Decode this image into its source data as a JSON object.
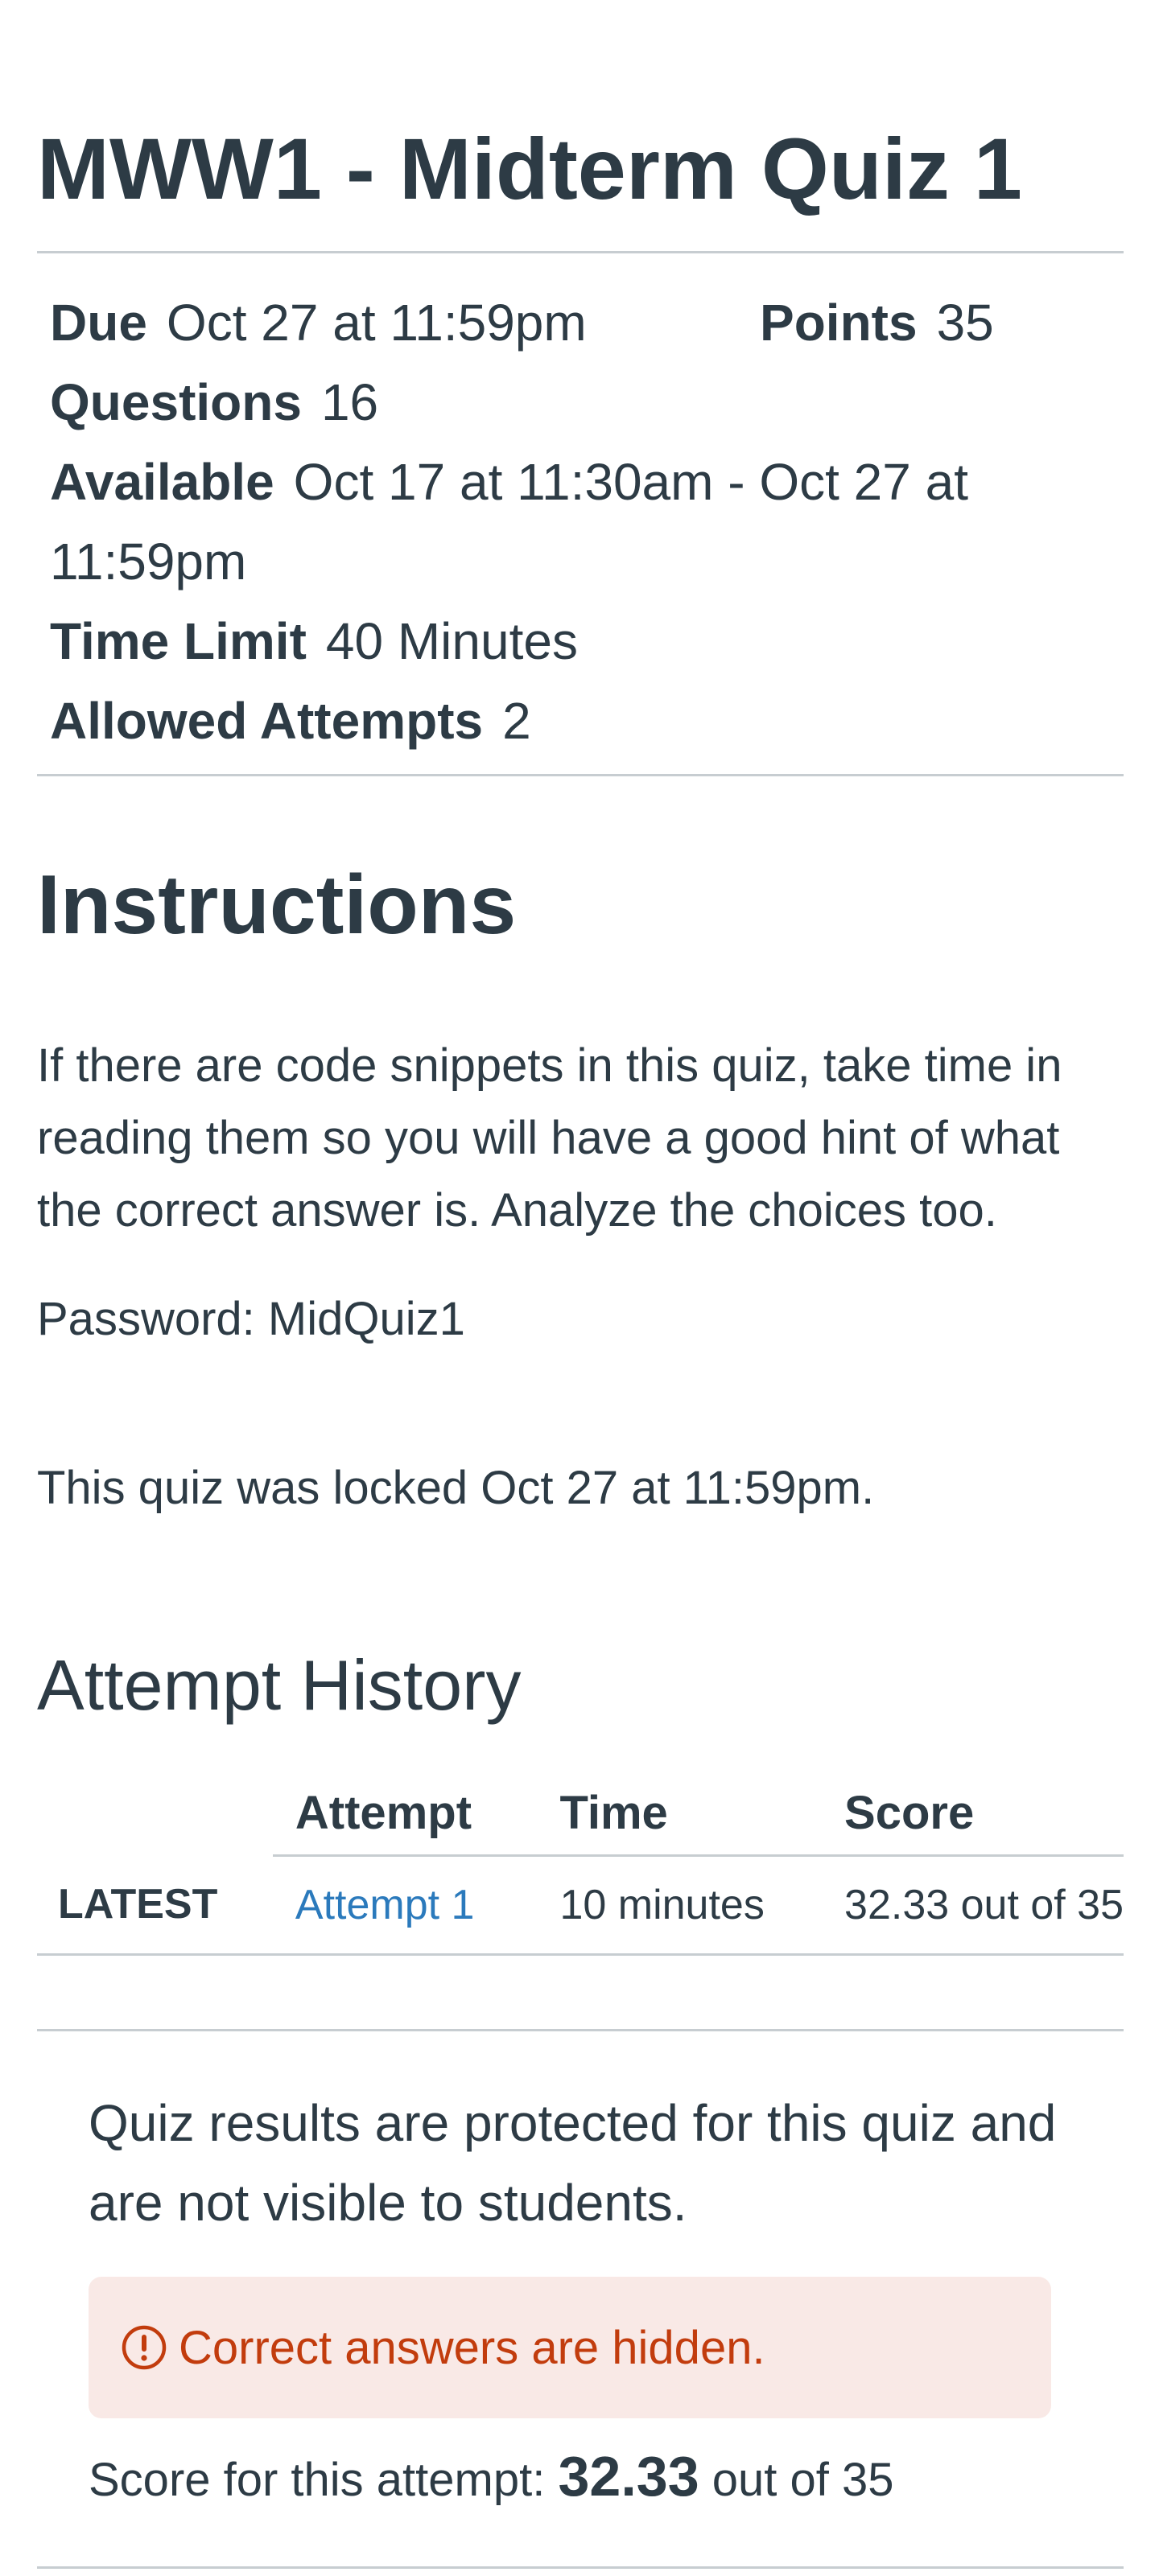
{
  "quiz": {
    "title": "MWW1 - Midterm Quiz 1"
  },
  "details": {
    "due_label": "Due",
    "due_value": "Oct 27 at 11:59pm",
    "points_label": "Points",
    "points_value": "35",
    "questions_label": "Questions",
    "questions_value": "16",
    "available_label": "Available",
    "available_value_line1": "Oct 17 at 11:30am - Oct 27 at",
    "available_value_line2": "11:59pm",
    "time_limit_label": "Time Limit",
    "time_limit_value": "40 Minutes",
    "attempts_label": "Allowed Attempts",
    "attempts_value": "2"
  },
  "instructions": {
    "heading": "Instructions",
    "text": "If there are code snippets in this quiz, take time in reading them so you will have a good hint of what the correct answer is. Analyze the choices too.",
    "password": "Password: MidQuiz1",
    "locked": "This quiz was locked Oct 27 at 11:59pm."
  },
  "attempt_history": {
    "heading": "Attempt History",
    "columns": [
      "",
      "Attempt",
      "Time",
      "Score"
    ],
    "rows": [
      {
        "tag": "LATEST",
        "attempt": "Attempt 1",
        "time": "10 minutes",
        "score": "32.33 out of 35"
      }
    ]
  },
  "results": {
    "protected_text": "Quiz results are protected for this quiz and are not visible to students.",
    "alert_text": "Correct answers are hidden.",
    "score_prefix": "Score for this attempt: ",
    "score_value": "32.33",
    "score_suffix": " out of 35"
  },
  "colors": {
    "text": "#2d3b45",
    "link": "#2b7abc",
    "alert_text": "#c23c0d",
    "alert_bg": "#f9e9e6",
    "rule": "#c7cdd1"
  },
  "icons": {
    "alert": "warning-circle-icon"
  }
}
